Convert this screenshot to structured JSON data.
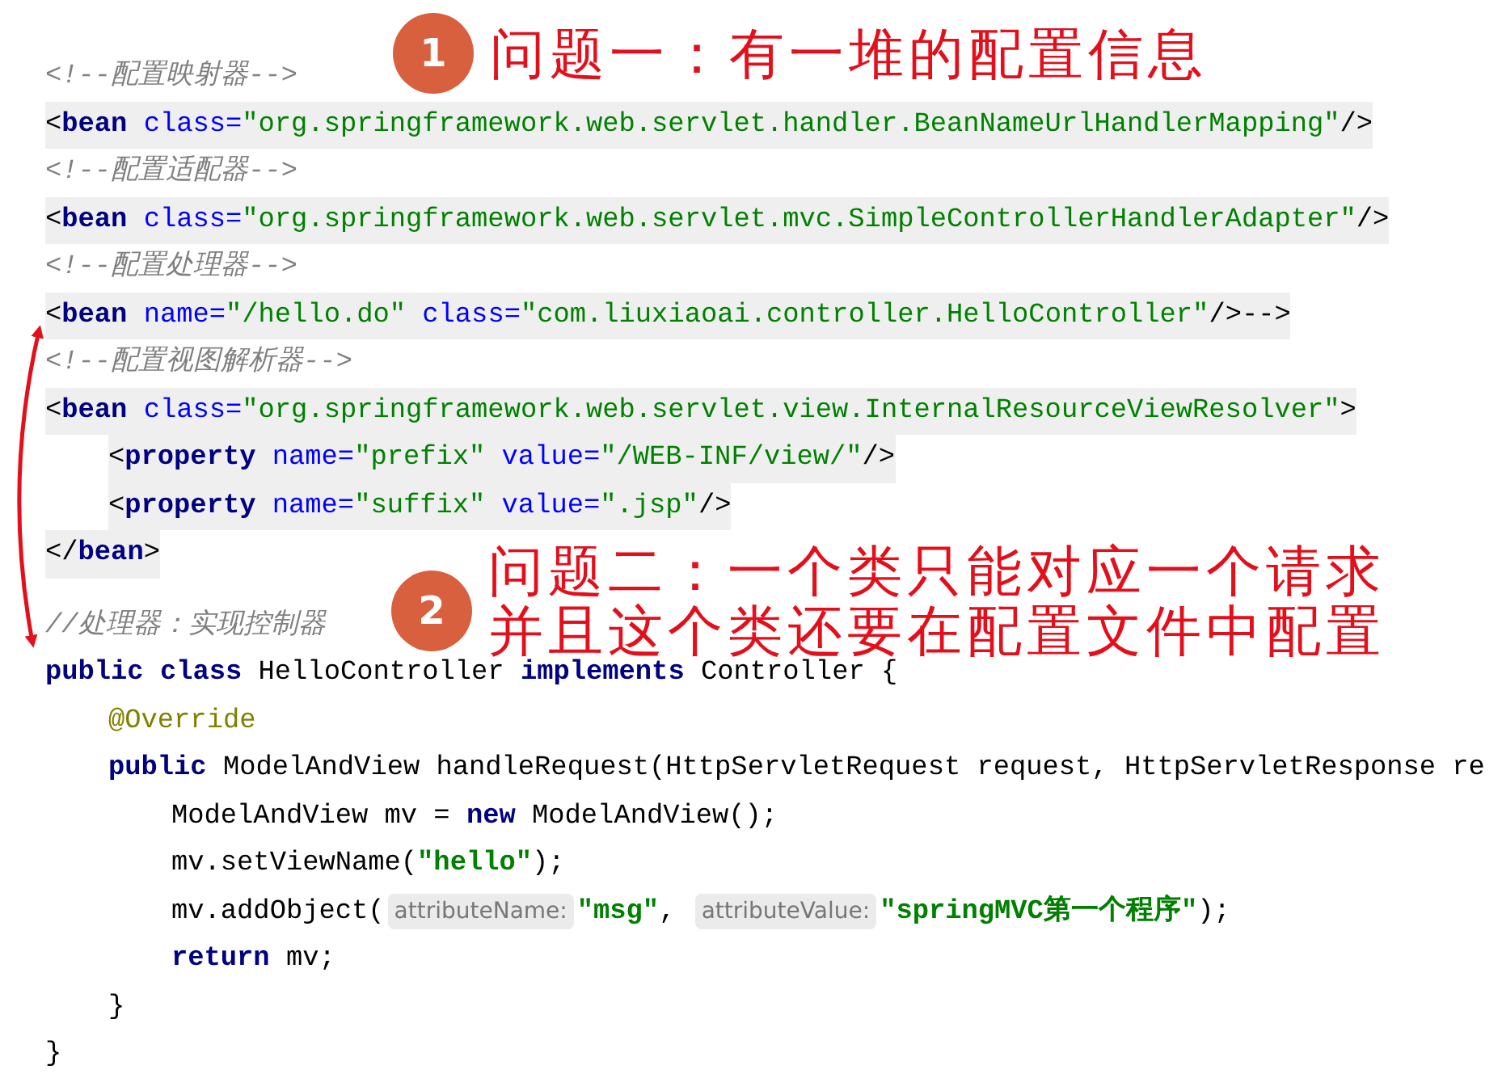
{
  "code_lines": [
    {
      "highlight": false,
      "tokens": [
        {
          "kind": "comment",
          "text": "<!--配置映射器-->"
        }
      ]
    },
    {
      "highlight": true,
      "tokens": [
        {
          "kind": "punct",
          "text": "<"
        },
        {
          "kind": "tag",
          "text": "bean"
        },
        {
          "kind": "attr",
          "text": " class="
        },
        {
          "kind": "str",
          "text": "\"org.springframework.web.servlet.handler.BeanNameUrlHandlerMapping\""
        },
        {
          "kind": "punct",
          "text": "/>"
        }
      ]
    },
    {
      "highlight": false,
      "tokens": [
        {
          "kind": "comment",
          "text": "<!--配置适配器-->"
        }
      ]
    },
    {
      "highlight": true,
      "tokens": [
        {
          "kind": "punct",
          "text": "<"
        },
        {
          "kind": "tag",
          "text": "bean"
        },
        {
          "kind": "attr",
          "text": " class="
        },
        {
          "kind": "str",
          "text": "\"org.springframework.web.servlet.mvc.SimpleControllerHandlerAdapter\""
        },
        {
          "kind": "punct",
          "text": "/>"
        }
      ]
    },
    {
      "highlight": false,
      "tokens": [
        {
          "kind": "comment",
          "text": "<!--配置处理器-->"
        }
      ]
    },
    {
      "highlight": true,
      "tokens": [
        {
          "kind": "punct",
          "text": "<"
        },
        {
          "kind": "tag",
          "text": "bean"
        },
        {
          "kind": "attr",
          "text": " name="
        },
        {
          "kind": "str",
          "text": "\"/hello.do\""
        },
        {
          "kind": "attr",
          "text": " class="
        },
        {
          "kind": "str",
          "text": "\"com.liuxiaoai.controller.HelloController\""
        },
        {
          "kind": "punct",
          "text": "/>-->"
        }
      ]
    },
    {
      "highlight": false,
      "tokens": [
        {
          "kind": "comment",
          "text": "<!--配置视图解析器-->"
        }
      ]
    },
    {
      "highlight": true,
      "tokens": [
        {
          "kind": "punct",
          "text": "<"
        },
        {
          "kind": "tag",
          "text": "bean"
        },
        {
          "kind": "attr",
          "text": " class="
        },
        {
          "kind": "str",
          "text": "\"org.springframework.web.servlet.view.InternalResourceViewResolver\""
        },
        {
          "kind": "punct",
          "text": ">"
        }
      ],
      "children": [
        {
          "highlight": true,
          "tokens": [
            {
              "kind": "punct",
              "text": "<"
            },
            {
              "kind": "tag",
              "text": "property"
            },
            {
              "kind": "attr",
              "text": " name="
            },
            {
              "kind": "str",
              "text": "\"prefix\""
            },
            {
              "kind": "attr",
              "text": " value="
            },
            {
              "kind": "str",
              "text": "\"/WEB-INF/view/\""
            },
            {
              "kind": "punct",
              "text": "/>"
            }
          ]
        },
        {
          "highlight": true,
          "tokens": [
            {
              "kind": "punct",
              "text": "<"
            },
            {
              "kind": "tag",
              "text": "property"
            },
            {
              "kind": "attr",
              "text": " name="
            },
            {
              "kind": "str",
              "text": "\"suffix\""
            },
            {
              "kind": "attr",
              "text": " value="
            },
            {
              "kind": "str",
              "text": "\".jsp\""
            },
            {
              "kind": "punct",
              "text": "/>"
            }
          ]
        }
      ]
    },
    {
      "highlight": true,
      "tokens": [
        {
          "kind": "punct",
          "text": "</"
        },
        {
          "kind": "tag",
          "text": "bean"
        },
        {
          "kind": "punct",
          "text": ">"
        }
      ]
    },
    {
      "highlight": false,
      "gap_before": true,
      "tokens": [
        {
          "kind": "comment",
          "text": "//处理器：实现控制器"
        }
      ]
    },
    {
      "highlight": false,
      "tokens": [
        {
          "kind": "keyword",
          "text": "public class"
        },
        {
          "kind": "plain",
          "text": " HelloController "
        },
        {
          "kind": "keyword",
          "text": "implements"
        },
        {
          "kind": "plain",
          "text": " Controller {"
        }
      ],
      "children": [
        {
          "highlight": false,
          "tokens": [
            {
              "kind": "anno",
              "text": "@Override"
            }
          ]
        },
        {
          "highlight": false,
          "tokens": [
            {
              "kind": "keyword",
              "text": "public"
            },
            {
              "kind": "plain",
              "text": " ModelAndView handleRequest(HttpServletRequest request, HttpServletResponse re"
            }
          ],
          "children": [
            {
              "highlight": false,
              "tokens": [
                {
                  "kind": "plain",
                  "text": "ModelAndView mv = "
                },
                {
                  "kind": "keyword",
                  "text": "new"
                },
                {
                  "kind": "plain",
                  "text": " ModelAndView();"
                }
              ]
            },
            {
              "highlight": false,
              "tokens": [
                {
                  "kind": "plain",
                  "text": "mv.setViewName("
                },
                {
                  "kind": "jstr",
                  "text": "\"hello\""
                },
                {
                  "kind": "plain",
                  "text": ");"
                }
              ]
            },
            {
              "highlight": false,
              "tokens": [
                {
                  "kind": "plain",
                  "text": "mv.addObject("
                },
                {
                  "kind": "hint",
                  "text": "attributeName:"
                },
                {
                  "kind": "jstr",
                  "text": "\"msg\""
                },
                {
                  "kind": "plain",
                  "text": ", "
                },
                {
                  "kind": "hint",
                  "text": "attributeValue:"
                },
                {
                  "kind": "jstr",
                  "text": "\"springMVC第一个程序\""
                },
                {
                  "kind": "plain",
                  "text": ");"
                }
              ]
            },
            {
              "highlight": false,
              "tokens": [
                {
                  "kind": "keyword",
                  "text": "return"
                },
                {
                  "kind": "plain",
                  "text": " mv;"
                }
              ]
            }
          ]
        },
        {
          "highlight": false,
          "tokens": [
            {
              "kind": "plain",
              "text": "}"
            }
          ]
        }
      ]
    },
    {
      "highlight": false,
      "tokens": [
        {
          "kind": "plain",
          "text": "}"
        }
      ]
    }
  ],
  "callouts": [
    {
      "number": "1",
      "lines": [
        "问题一：有一堆的配置信息"
      ]
    },
    {
      "number": "2",
      "lines": [
        "问题二：一个类只能对应一个请求",
        "并且这个类还要在配置文件中配置"
      ]
    }
  ]
}
